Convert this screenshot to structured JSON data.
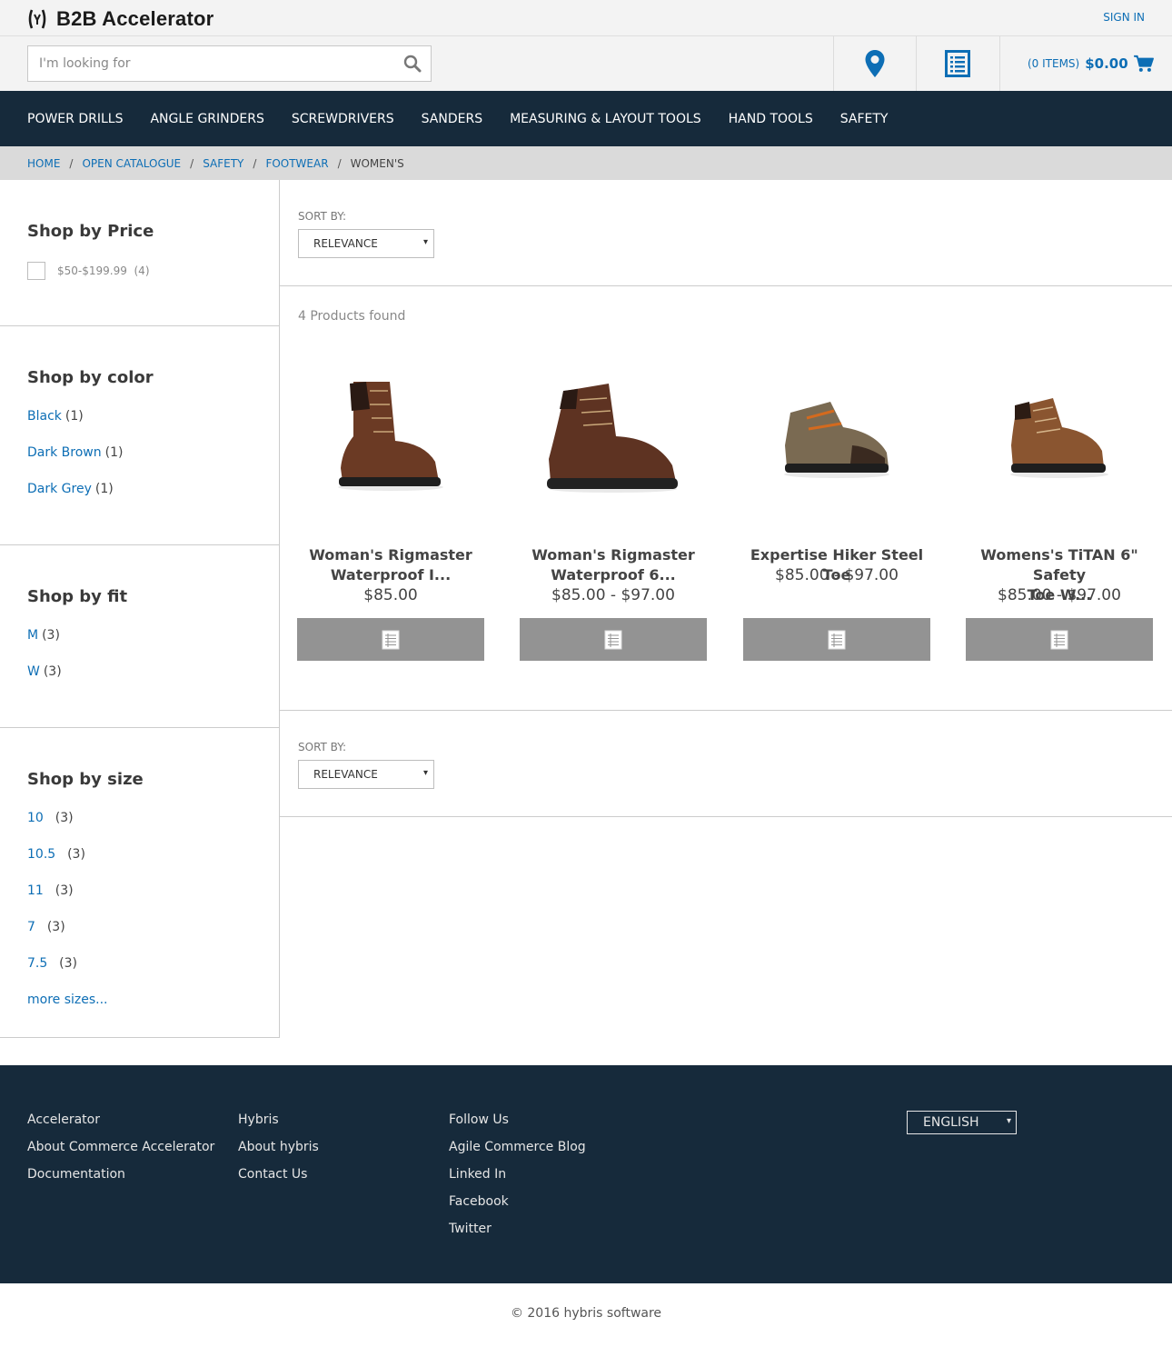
{
  "header": {
    "brand": "B2B Accelerator",
    "sign_in": "SIGN IN",
    "search_placeholder": "I'm looking for",
    "cart_items": "(0 ITEMS)",
    "cart_total": "$0.00"
  },
  "nav": [
    "POWER DRILLS",
    "ANGLE GRINDERS",
    "SCREWDRIVERS",
    "SANDERS",
    "MEASURING & LAYOUT TOOLS",
    "HAND TOOLS",
    "SAFETY"
  ],
  "breadcrumb": {
    "links": [
      "HOME",
      "OPEN CATALOGUE",
      "SAFETY",
      "FOOTWEAR"
    ],
    "current": "WOMEN'S",
    "separator": "/"
  },
  "facets": {
    "price": {
      "title": "Shop by Price",
      "options": [
        {
          "label": "$50-$199.99",
          "count": "(4)",
          "checked": false
        }
      ]
    },
    "color": {
      "title": "Shop by color",
      "options": [
        {
          "label": "Black",
          "count": "(1)"
        },
        {
          "label": "Dark Brown",
          "count": "(1)"
        },
        {
          "label": "Dark Grey",
          "count": "(1)"
        }
      ]
    },
    "fit": {
      "title": "Shop by fit",
      "options": [
        {
          "label": "M",
          "count": "(3)"
        },
        {
          "label": "W",
          "count": "(3)"
        }
      ]
    },
    "size": {
      "title": "Shop by size",
      "options": [
        {
          "label": "10",
          "count": "(3)"
        },
        {
          "label": "10.5",
          "count": "(3)"
        },
        {
          "label": "11",
          "count": "(3)"
        },
        {
          "label": "7",
          "count": "(3)"
        },
        {
          "label": "7.5",
          "count": "(3)"
        }
      ],
      "more": "more sizes..."
    }
  },
  "sort": {
    "label": "SORT BY:",
    "value": "RELEVANCE",
    "arrow": "▾"
  },
  "results_count": "4 Products found",
  "products": [
    {
      "name_line1": "Woman's Rigmaster",
      "name_line2": "Waterproof I...",
      "price": "$85.00",
      "shoe_color": "#6b3a24"
    },
    {
      "name_line1": "Woman's Rigmaster",
      "name_line2": "Waterproof 6...",
      "price": "$85.00 - $97.00",
      "shoe_color": "#5e3322"
    },
    {
      "name_line1": "Expertise Hiker Steel Toe",
      "name_line2": "",
      "price": "$85.00 - $97.00",
      "shoe_color": "#7a6a52"
    },
    {
      "name_line1": "Womens's TiTAN 6\" Safety",
      "name_line2": "Toe W...",
      "price": "$85.00 - $97.00",
      "shoe_color": "#8a5530"
    }
  ],
  "footer": {
    "columns": [
      [
        "Accelerator",
        "About Commerce Accelerator",
        "Documentation"
      ],
      [
        "Hybris",
        "About hybris",
        "Contact Us"
      ],
      [
        "Follow Us",
        "Agile Commerce Blog",
        "Linked In",
        "Facebook",
        "Twitter"
      ]
    ],
    "language": "ENGLISH",
    "copyright": "© 2016 hybris software"
  },
  "colors": {
    "nav_bg": "#162a3b",
    "link": "#0d6eb5",
    "button_gray": "#939393"
  }
}
